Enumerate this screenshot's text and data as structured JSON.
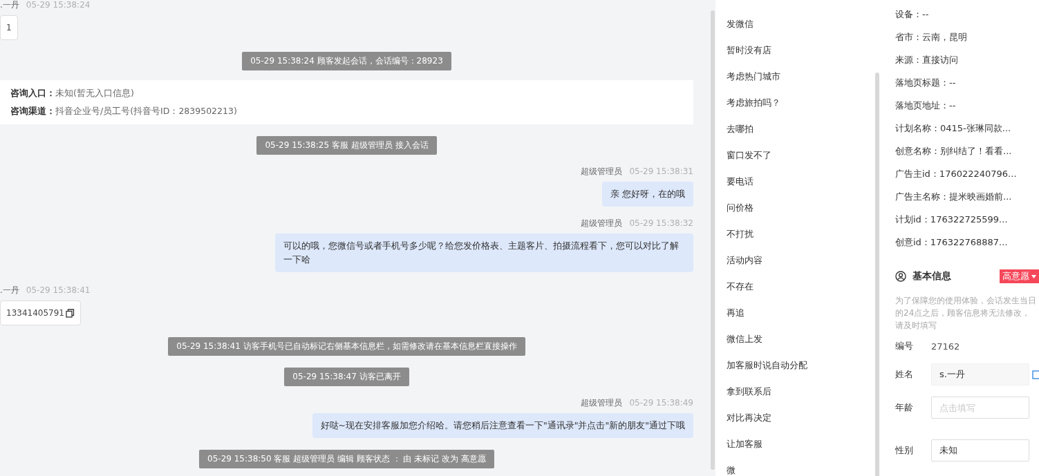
{
  "chat": {
    "messages": [
      {
        "kind": "visitor",
        "name": ".一丹",
        "time": "05-29 15:38:24",
        "text": "1"
      },
      {
        "kind": "system",
        "text": "05-29 15:38:24 顾客发起会话，会话编号：28923"
      },
      {
        "kind": "info",
        "rows": [
          {
            "label": "咨询入口：",
            "value": "未知(暂无入口信息)"
          },
          {
            "label": "咨询渠道：",
            "value": "抖音企业号/员工号(抖音号ID：2839502213)"
          }
        ]
      },
      {
        "kind": "system",
        "text": "05-29 15:38:25 客服 超级管理员 接入会话"
      },
      {
        "kind": "agent",
        "name": "超级管理员",
        "time": "05-29 15:38:31",
        "text": "亲 您好呀，在的哦"
      },
      {
        "kind": "agent",
        "name": "超级管理员",
        "time": "05-29 15:38:32",
        "text": "可以的哦，您微信号或者手机号多少呢？给您发价格表、主题客片、拍摄流程看下，您可以对比了解一下哈"
      },
      {
        "kind": "visitor",
        "name": ".一丹",
        "time": "05-29 15:38:41",
        "text": "13341405791",
        "copy": true
      },
      {
        "kind": "system",
        "text": "05-29 15:38:41 访客手机号已自动标记右侧基本信息栏，如需修改请在基本信息栏直接操作"
      },
      {
        "kind": "system",
        "text": "05-29 15:38:47 访客已离开"
      },
      {
        "kind": "agent",
        "name": "超级管理员",
        "time": "05-29 15:38:49",
        "text": "好哒~现在安排客服加您介绍哈。请您稍后注意查看一下\"通讯录\"并点击\"新的朋友\"通过下哦"
      },
      {
        "kind": "system",
        "text": "05-29 15:38:50 客服 超级管理员 编辑 顾客状态 ： 由 未标记 改为 高意愿"
      }
    ]
  },
  "quick_replies": [
    "发微信",
    "暂时没有店",
    "考虑热门城市",
    "考虑旅拍吗？",
    "去哪拍",
    "窗口发不了",
    "要电话",
    "问价格",
    "不打扰",
    "活动内容",
    "不存在",
    "再追",
    "微信上发",
    "加客服时说自动分配",
    "拿到联系后",
    "对比再决定",
    "让加客服",
    "微"
  ],
  "visitor_info": [
    "设备：--",
    "省市：云南，昆明",
    "来源：直接访问",
    "落地页标题：--",
    "落地页地址：--",
    "计划名称：0415-张琳同款...",
    "创意名称：别纠结了！看看...",
    "广告主id：176022240796...",
    "广告主名称：提米映画婚前...",
    "计划id：176322725599...",
    "创意id：176322768887..."
  ],
  "basic_info": {
    "title": "基本信息",
    "status_tag": "高意愿",
    "note": "为了保障您的使用体验，会话发生当日的24点之后，顾客信息将无法修改，请及时填写",
    "fields": [
      {
        "kind": "text",
        "label": "编号",
        "value": "27162"
      },
      {
        "kind": "readonly",
        "label": "姓名",
        "value": "s.一丹"
      },
      {
        "kind": "input",
        "label": "年龄",
        "placeholder": "点击填写"
      },
      {
        "kind": "input",
        "label": "性别",
        "value": "未知"
      }
    ]
  }
}
